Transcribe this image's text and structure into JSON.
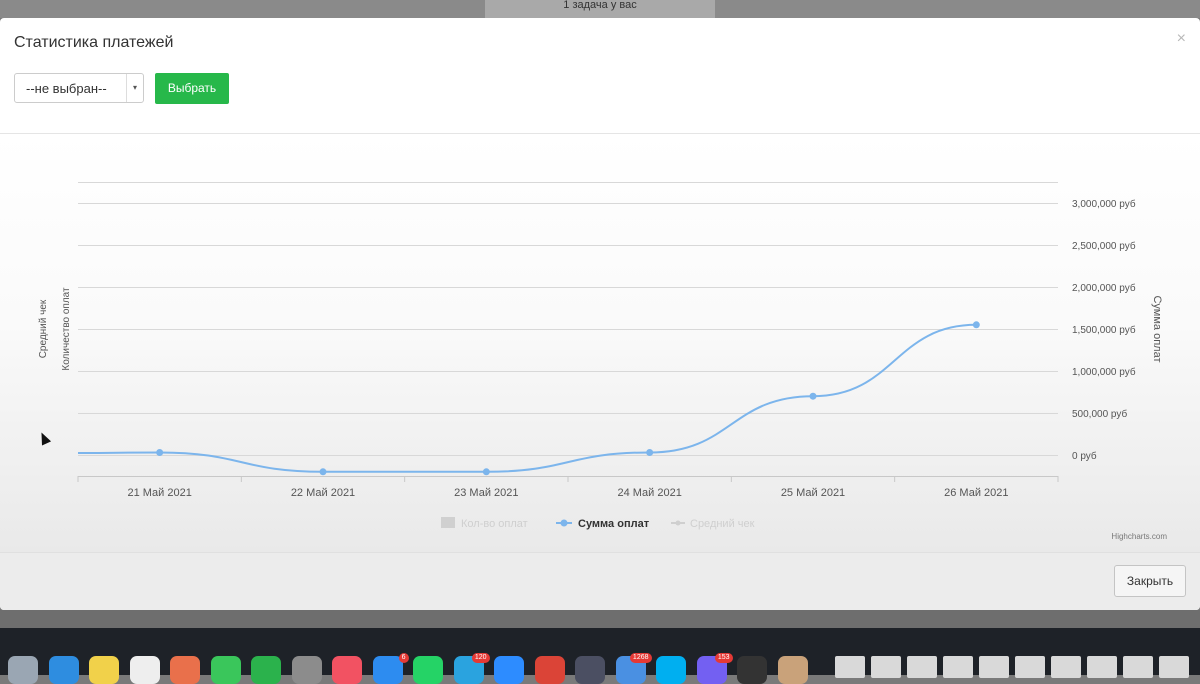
{
  "backdrop": {
    "note_line1": "1 задача у вас",
    "note_line2": ""
  },
  "modal": {
    "title": "Статистика платежей",
    "close_icon": "×",
    "select": {
      "value": "--не выбран--",
      "arrow": "▾"
    },
    "choose_label": "Выбрать",
    "close_label": "Закрыть"
  },
  "chart_data": {
    "type": "line",
    "x": [
      "21 Май 2021",
      "22 Май 2021",
      "23 Май 2021",
      "24 Май 2021",
      "25 Май 2021",
      "26 Май 2021"
    ],
    "series": [
      {
        "name": "Кол-во оплат",
        "type": "bar",
        "values": [],
        "visible": false
      },
      {
        "name": "Сумма оплат",
        "type": "line",
        "values": [
          30000,
          -200000,
          -200000,
          30000,
          700000,
          1550000
        ],
        "color": "#7cb5ec",
        "visible": true
      },
      {
        "name": "Средний чек",
        "type": "line",
        "values": [],
        "visible": false
      }
    ],
    "yaxis_right": {
      "label": "Сумма оплат",
      "ticks": [
        "3,000,000 руб",
        "2,500,000 руб",
        "2,000,000 руб",
        "1,500,000 руб",
        "1,000,000 руб",
        "500,000 руб",
        "0 руб"
      ],
      "range": [
        -250000,
        3250000
      ]
    },
    "yaxis_left_labels": [
      "Средний чек",
      "Количество оплат"
    ],
    "legend_position": "bottom-center",
    "credits": "Highcharts.com",
    "grid": true
  },
  "dock": {
    "icons": [
      {
        "name": "launchpad-icon",
        "color": "#9aa6b3"
      },
      {
        "name": "safari-icon",
        "color": "#2e8de0"
      },
      {
        "name": "notes-icon",
        "color": "#f1d14a"
      },
      {
        "name": "reminders-icon",
        "color": "#eeeeee"
      },
      {
        "name": "photos-icon",
        "color": "#e9704b"
      },
      {
        "name": "facetime-icon",
        "color": "#3ac65b"
      },
      {
        "name": "numbers-icon",
        "color": "#2bb24c"
      },
      {
        "name": "settings-icon",
        "color": "#8c8c8c"
      },
      {
        "name": "music-icon",
        "color": "#f25262"
      },
      {
        "name": "appstore-icon",
        "color": "#2d8cf0",
        "badge": "6"
      },
      {
        "name": "whatsapp-icon",
        "color": "#25d366"
      },
      {
        "name": "telegram-icon",
        "color": "#2aa3df",
        "badge": "120"
      },
      {
        "name": "zoom-icon",
        "color": "#2d8cff"
      },
      {
        "name": "chrome-icon",
        "color": "#db4437"
      },
      {
        "name": "teams-icon",
        "color": "#4b4f62"
      },
      {
        "name": "mail-icon",
        "color": "#4a90e2",
        "badge": "1268"
      },
      {
        "name": "skype-icon",
        "color": "#00aff0"
      },
      {
        "name": "viber-icon",
        "color": "#7360f2",
        "badge": "153"
      },
      {
        "name": "terminal-icon",
        "color": "#333333"
      },
      {
        "name": "preview-icon",
        "color": "#c9a27a"
      }
    ],
    "badges": [
      "6",
      "120",
      "1268",
      "153"
    ]
  }
}
